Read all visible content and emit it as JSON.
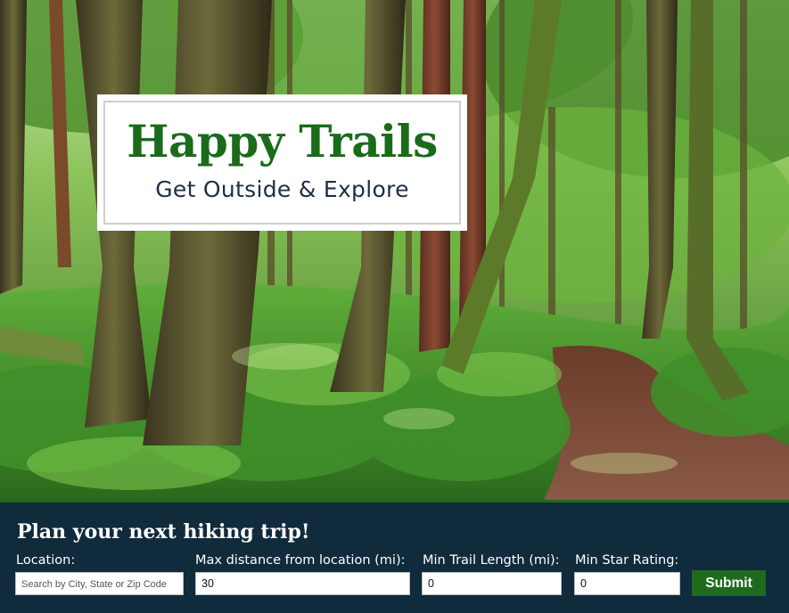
{
  "hero": {
    "title": "Happy Trails",
    "subtitle": "Get Outside & Explore"
  },
  "form": {
    "heading": "Plan your next hiking trip!",
    "location": {
      "label": "Location:",
      "placeholder": "Search by City, State or Zip Code",
      "value": ""
    },
    "max_distance": {
      "label": "Max distance from location (mi):",
      "value": "30"
    },
    "min_length": {
      "label": "Min Trail Length (mi):",
      "value": "0"
    },
    "min_rating": {
      "label": "Min Star Rating:",
      "value": "0"
    },
    "submit_label": "Submit"
  },
  "colors": {
    "brand_green": "#1a6b1a",
    "panel_bg": "#0f2b3c",
    "button_green": "#1e6b1e"
  }
}
